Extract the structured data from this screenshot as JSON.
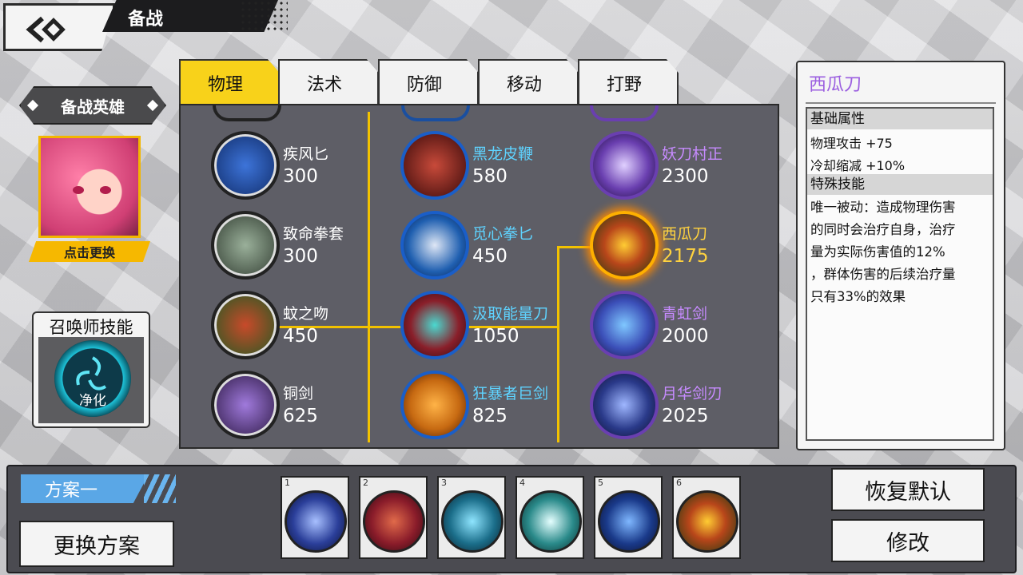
{
  "header": {
    "title": "备战"
  },
  "hero": {
    "label": "备战英雄",
    "change_label": "点击更换"
  },
  "summoner": {
    "title": "召唤师技能",
    "skill_name": "净化"
  },
  "tabs": [
    {
      "label": "物理",
      "active": true
    },
    {
      "label": "法术",
      "active": false
    },
    {
      "label": "防御",
      "active": false
    },
    {
      "label": "移动",
      "active": false
    },
    {
      "label": "打野",
      "active": false
    }
  ],
  "items": {
    "col1": [
      {
        "name": "疾风匕",
        "price": "300",
        "icon": "dagger-icon",
        "color": "#1f4fa8"
      },
      {
        "name": "致命拳套",
        "price": "300",
        "icon": "gauntlet-icon",
        "color": "#4a5b4a"
      },
      {
        "name": "蚊之吻",
        "price": "450",
        "icon": "sword-icon",
        "color": "#2e7d32"
      },
      {
        "name": "铜剑",
        "price": "625",
        "icon": "sword-icon",
        "color": "#4b2c5e"
      }
    ],
    "col2": [
      {
        "name": "黑龙皮鞭",
        "price": "580",
        "icon": "whip-icon",
        "color": "#7a1c1c"
      },
      {
        "name": "觅心拳匕",
        "price": "450",
        "icon": "blade-icon",
        "color": "#1f5fb0"
      },
      {
        "name": "汲取能量刀",
        "price": "1050",
        "icon": "blade-icon",
        "color": "#8a1f2a"
      },
      {
        "name": "狂暴者巨剑",
        "price": "825",
        "icon": "greatsword-icon",
        "color": "#c76a12"
      }
    ],
    "col3": [
      {
        "name": "妖刀村正",
        "price": "2300",
        "icon": "katana-icon",
        "color": "#6a3fb0"
      },
      {
        "name": "西瓜刀",
        "price": "2175",
        "icon": "watermelon-blade-icon",
        "color": "#b8461a"
      },
      {
        "name": "青虹剑",
        "price": "2000",
        "icon": "sword-icon",
        "color": "#3b4fb8"
      },
      {
        "name": "月华剑刃",
        "price": "2025",
        "icon": "blade-icon",
        "color": "#2a3a8a"
      }
    ]
  },
  "detail": {
    "name": "西瓜刀",
    "base_title": "基础属性",
    "stats": [
      "物理攻击 +75",
      "冷却缩减 +10%"
    ],
    "special_title": "特殊技能",
    "description": [
      "唯一被动：造成物理伤害",
      "的同时会治疗自身，治疗",
      "量为实际伤害值的12%",
      "，群体伤害的后续治疗量",
      "只有33%的效果"
    ]
  },
  "bottom": {
    "plan_label": "方案一",
    "switch_label": "更换方案",
    "restore_label": "恢复默认",
    "edit_label": "修改",
    "slots": [
      {
        "num": "1",
        "icon": "boots-icon",
        "color": "#2b3f9a"
      },
      {
        "num": "2",
        "icon": "whip-icon",
        "color": "#8a1c2a"
      },
      {
        "num": "3",
        "icon": "scythe-icon",
        "color": "#1b6e8a"
      },
      {
        "num": "4",
        "icon": "armor-icon",
        "color": "#2a8a8a"
      },
      {
        "num": "5",
        "icon": "blade-icon",
        "color": "#1a3a8a"
      },
      {
        "num": "6",
        "icon": "watermelon-blade-icon",
        "color": "#b8461a"
      }
    ]
  }
}
